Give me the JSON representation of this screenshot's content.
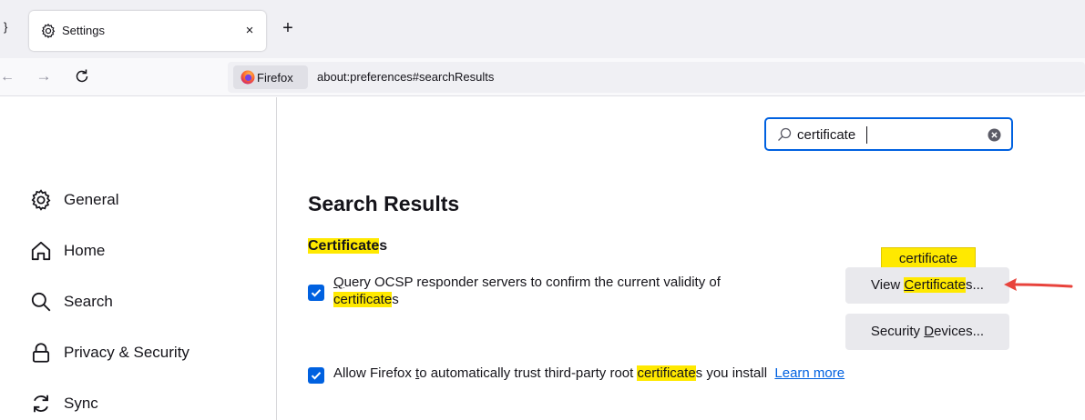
{
  "tabs": [
    {
      "title": "Settings",
      "icon": "gear-icon"
    }
  ],
  "tabstrip": {
    "stub_text": "}",
    "close_glyph": "×",
    "new_tab_glyph": "+"
  },
  "nav": {
    "back_glyph": "←",
    "forward_glyph": "→",
    "identity_label": "Firefox",
    "url": "about:preferences#searchResults"
  },
  "sidebar": {
    "items": [
      {
        "label": "General",
        "icon": "gear-icon"
      },
      {
        "label": "Home",
        "icon": "home-icon"
      },
      {
        "label": "Search",
        "icon": "search-icon"
      },
      {
        "label": "Privacy & Security",
        "icon": "lock-icon"
      },
      {
        "label": "Sync",
        "icon": "sync-icon"
      }
    ]
  },
  "search": {
    "value": "certificate"
  },
  "main": {
    "results_title": "Search Results",
    "section_title_highlight": "Certificate",
    "section_title_rest": "s",
    "ocsp": {
      "checked": true,
      "part1_underlined": "Q",
      "part1_rest": "uery OCSP responder servers to confirm the current validity of",
      "highlight": "certificate",
      "suffix": "s"
    },
    "trust": {
      "checked": true,
      "prefix_before_t": "Allow Firefox ",
      "underlined_t": "t",
      "prefix_after_t": "o automatically trust third-party root ",
      "highlight": "certificate",
      "suffix": "s you install",
      "learn_more": "Learn more"
    },
    "tooltip": "certificate",
    "view_certificates": {
      "prefix": "View ",
      "underlined": "C",
      "highlight_rest": "ertificate",
      "suffix": "s..."
    },
    "security_devices": {
      "prefix": "Security ",
      "underlined": "D",
      "suffix": "evices..."
    }
  },
  "colors": {
    "accent": "#0061e0",
    "highlight": "#ffe900",
    "annotation_arrow": "#e8433c",
    "button_bg": "#e9e9ed"
  }
}
